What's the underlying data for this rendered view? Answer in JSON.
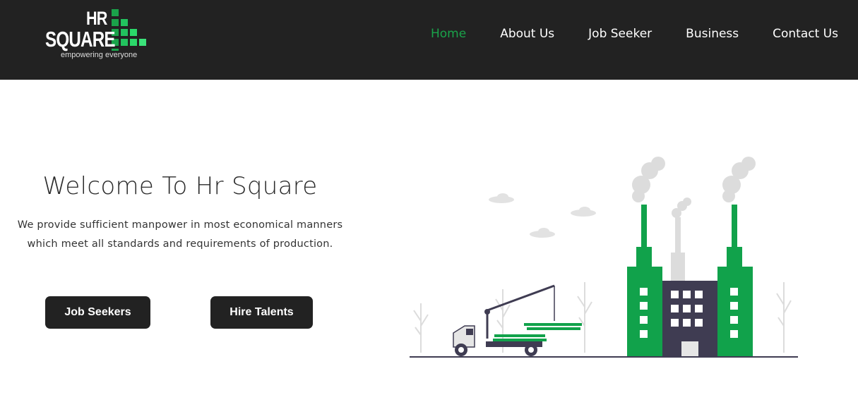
{
  "header": {
    "logo": {
      "line1": "HR",
      "line2": "SQUARE",
      "tagline": "empowering  everyone"
    },
    "nav": [
      {
        "label": "Home",
        "active": true
      },
      {
        "label": "About Us",
        "active": false
      },
      {
        "label": "Job Seeker",
        "active": false
      },
      {
        "label": "Business",
        "active": false
      },
      {
        "label": "Contact Us",
        "active": false
      }
    ]
  },
  "hero": {
    "title": "Welcome To Hr Square",
    "description_line1": "We provide sufficient manpower in most economical manners",
    "description_line2": "which meet all standards and requirements of production.",
    "buttons": {
      "job_seekers": "Job Seekers",
      "hire_talents": "Hire Talents"
    }
  },
  "colors": {
    "header_bg": "#222222",
    "accent_green": "#1aa34a",
    "button_bg": "#222222"
  },
  "illustration": {
    "subject": "factory-with-crane-truck-illustration"
  }
}
